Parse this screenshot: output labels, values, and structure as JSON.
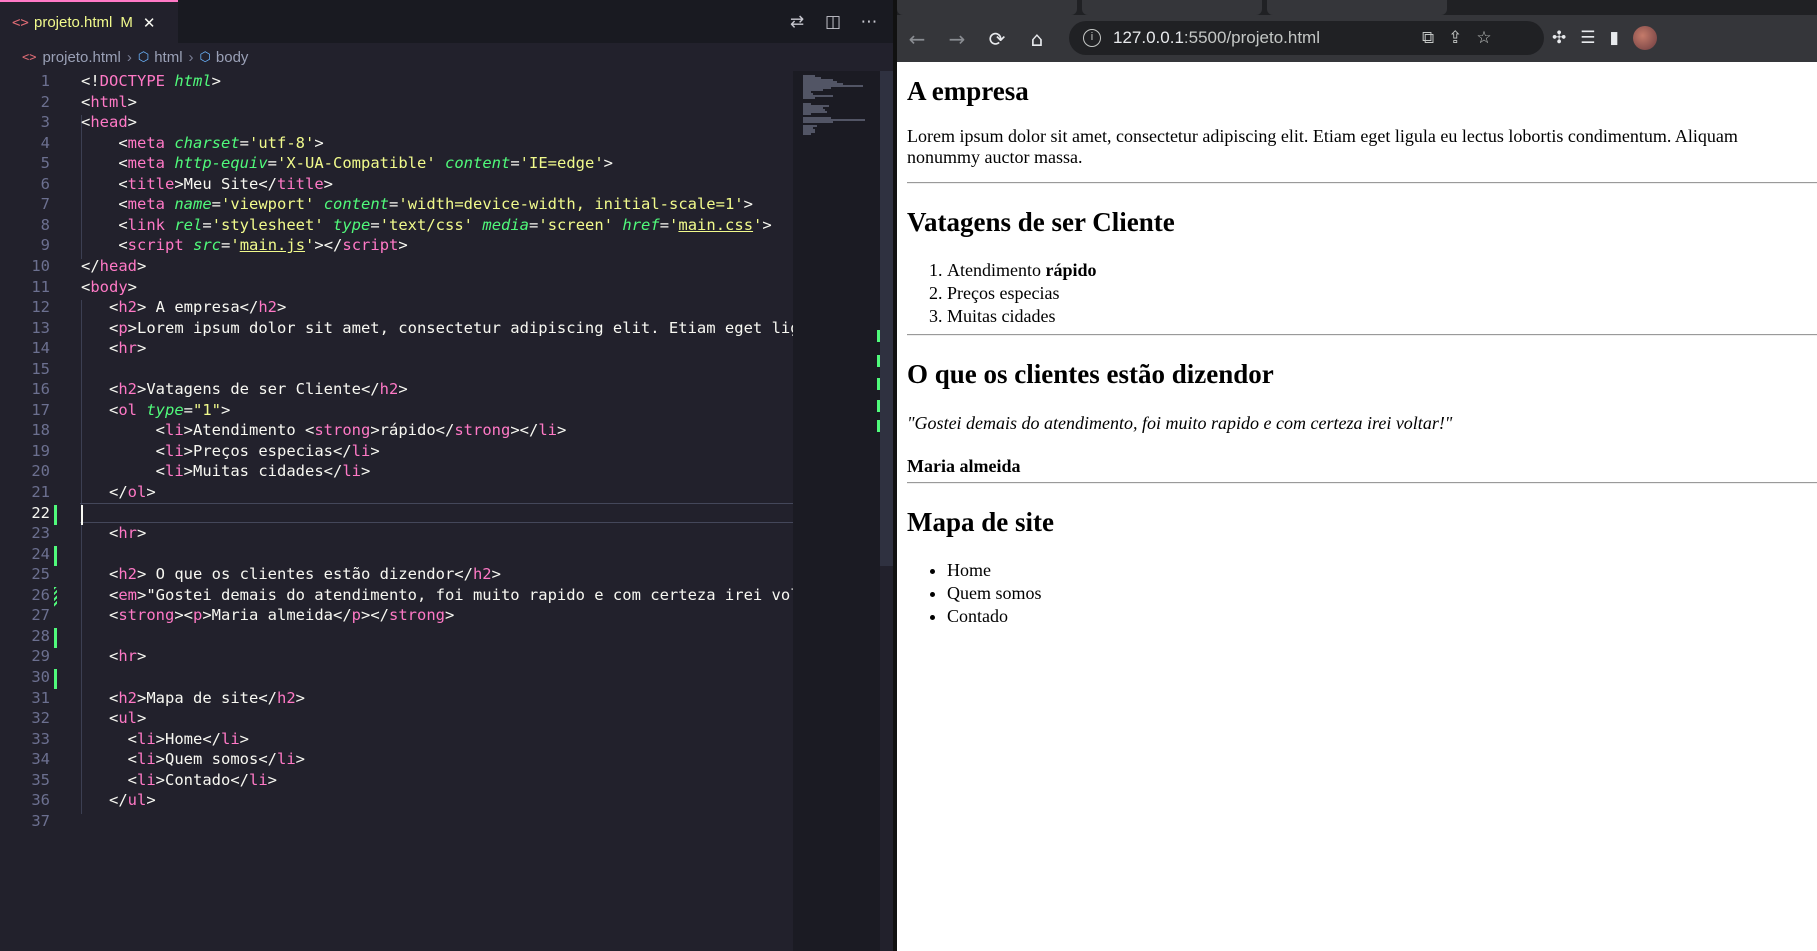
{
  "editor": {
    "tab": {
      "icon": "html-file-icon",
      "filename": "projeto.html",
      "modified": "M",
      "close": "✕"
    },
    "toolbar_actions": [
      "compare-changes-icon",
      "split-editor-icon",
      "more-actions-icon"
    ],
    "breadcrumb": {
      "file": "projeto.html",
      "html": "html",
      "body": "body"
    },
    "active_line": 22,
    "lines": [
      {
        "n": "1"
      },
      {
        "n": "2"
      },
      {
        "n": "3"
      },
      {
        "n": "4"
      },
      {
        "n": "5"
      },
      {
        "n": "6"
      },
      {
        "n": "7"
      },
      {
        "n": "8"
      },
      {
        "n": "9"
      },
      {
        "n": "10"
      },
      {
        "n": "11"
      },
      {
        "n": "12"
      },
      {
        "n": "13"
      },
      {
        "n": "14"
      },
      {
        "n": "15"
      },
      {
        "n": "16"
      },
      {
        "n": "17"
      },
      {
        "n": "18"
      },
      {
        "n": "19"
      },
      {
        "n": "20"
      },
      {
        "n": "21"
      },
      {
        "n": "22"
      },
      {
        "n": "23"
      },
      {
        "n": "24"
      },
      {
        "n": "25"
      },
      {
        "n": "26"
      },
      {
        "n": "27"
      },
      {
        "n": "28"
      },
      {
        "n": "29"
      },
      {
        "n": "30"
      },
      {
        "n": "31"
      },
      {
        "n": "32"
      },
      {
        "n": "33"
      },
      {
        "n": "34"
      },
      {
        "n": "35"
      },
      {
        "n": "36"
      },
      {
        "n": "37"
      }
    ],
    "colors": {
      "tag": "#ff79c6",
      "attr": "#50fa7b",
      "string": "#f1fa8c",
      "text": "#f8f8f2",
      "bg": "#22212c"
    }
  },
  "browser": {
    "url_host": "127.0.0.1",
    "url_path": ":5500/projeto.html",
    "nav": {
      "back": "←",
      "forward": "→",
      "reload": "⟳",
      "home": "⌂"
    },
    "page": {
      "h_empresa": "A empresa",
      "p_lorem_1": "Lorem ipsum dolor sit amet, consectetur adipiscing elit. Etiam eget ligula eu lectus lobortis condimentum. Aliquam",
      "p_lorem_2": "nonummy auctor massa.",
      "h_vantagens": "Vatagens de ser Cliente",
      "ol": {
        "item1_text": "Atendimento ",
        "item1_strong": "rápido",
        "item2": "Preços especias",
        "item3": "Muitas cidades"
      },
      "h_clientes": "O que os clientes estão dizendor",
      "quote": "\"Gostei demais do atendimento, foi muito rapido e com certeza irei voltar!\"",
      "author": "Maria almeida",
      "h_mapa": "Mapa de site",
      "ul": [
        "Home",
        "Quem somos",
        "Contado"
      ]
    }
  }
}
